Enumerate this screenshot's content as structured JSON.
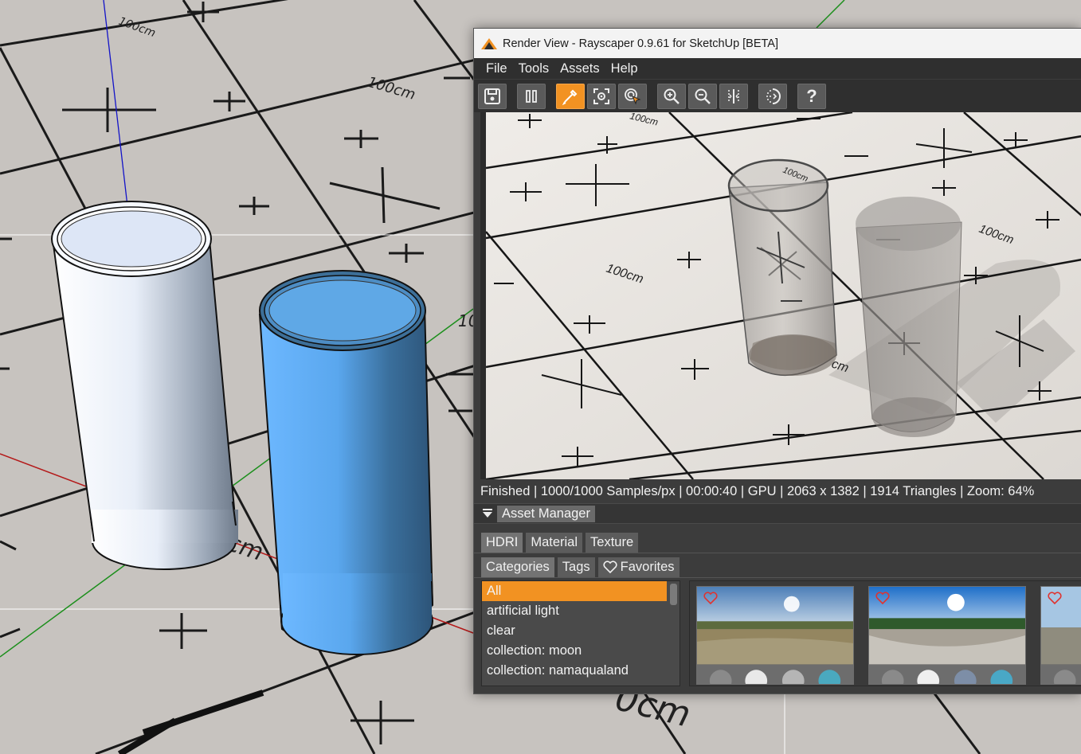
{
  "viewport": {
    "grid_label": "100cm",
    "grid_label_partial_1": "cm",
    "grid_label_partial_2": "0cm",
    "grid_label_partial_3": "10"
  },
  "window": {
    "title": "Render View - Rayscaper 0.9.61 for SketchUp [BETA]",
    "menu": [
      "File",
      "Tools",
      "Assets",
      "Help"
    ],
    "toolbar": [
      {
        "name": "save-icon",
        "active": false
      },
      {
        "name": "pause-icon",
        "active": false
      },
      {
        "name": "pick-material-icon",
        "active": true
      },
      {
        "name": "focus-icon",
        "active": false
      },
      {
        "name": "pick-focus-icon",
        "active": false
      },
      {
        "name": "zoom-in-icon",
        "active": false
      },
      {
        "name": "zoom-out-icon",
        "active": false
      },
      {
        "name": "compare-icon",
        "active": false
      },
      {
        "name": "denoise-icon",
        "active": false
      },
      {
        "name": "help-icon",
        "active": false
      }
    ],
    "help_label": "?",
    "render_labels": {
      "a": "100cm",
      "b": "100cm",
      "c": "100cm",
      "d": "100cm",
      "e": "cm"
    },
    "status": "Finished | 1000/1000 Samples/px | 00:00:40 | GPU | 2063 x 1382 | 1914 Triangles | Zoom: 64%"
  },
  "asset_manager": {
    "title": "Asset Manager",
    "type_tabs": [
      "HDRI",
      "Material",
      "Texture"
    ],
    "filter_tabs": [
      "Categories",
      "Tags",
      "Favorites"
    ],
    "categories": [
      "All",
      "artificial light",
      "clear",
      "collection: moon",
      "collection: namaqualand"
    ],
    "selected_category": "All"
  },
  "colors": {
    "accent": "#f29222",
    "cylinder_white": "#e6eefa",
    "cylinder_blue": "#5aa7ee",
    "heart": "#e0332f"
  }
}
